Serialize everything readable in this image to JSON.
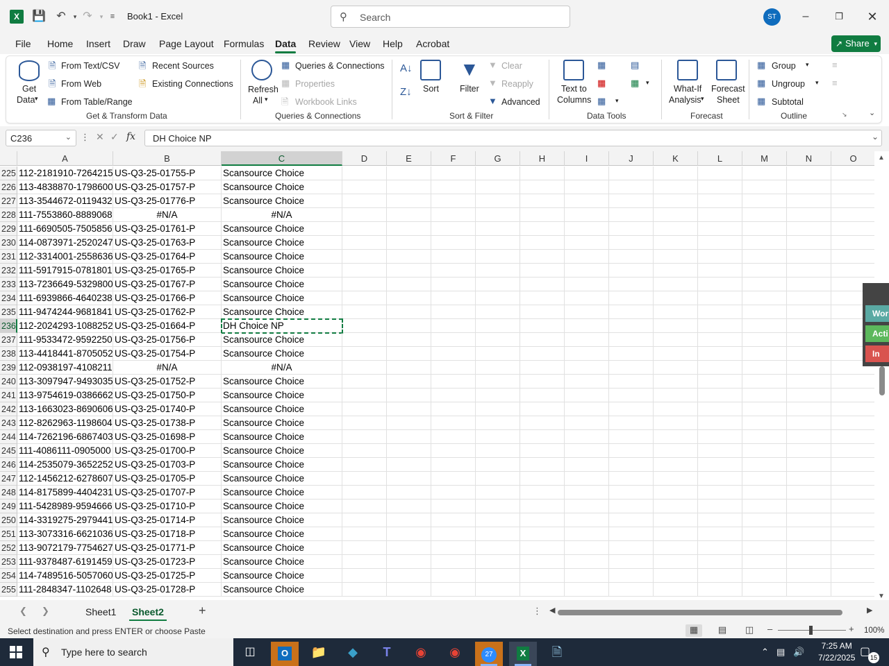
{
  "window": {
    "title": "Book1  -  Excel",
    "app_logo": "X",
    "search_placeholder": "Search",
    "user_initials": "ST"
  },
  "tabs": [
    {
      "label": "File"
    },
    {
      "label": "Home"
    },
    {
      "label": "Insert"
    },
    {
      "label": "Draw"
    },
    {
      "label": "Page Layout"
    },
    {
      "label": "Formulas"
    },
    {
      "label": "Data",
      "active": true
    },
    {
      "label": "Review"
    },
    {
      "label": "View"
    },
    {
      "label": "Help"
    },
    {
      "label": "Acrobat"
    }
  ],
  "share_label": "Share",
  "ribbon": {
    "get_transform": {
      "get_data": "Get",
      "get_data2": "Data",
      "from_text_csv": "From Text/CSV",
      "from_web": "From Web",
      "from_table_range": "From Table/Range",
      "recent_sources": "Recent Sources",
      "existing_connections": "Existing Connections",
      "group_label": "Get & Transform Data"
    },
    "queries": {
      "refresh": "Refresh",
      "refresh_all": "All",
      "queries_connections": "Queries & Connections",
      "properties": "Properties",
      "workbook_links": "Workbook Links",
      "group_label": "Queries & Connections"
    },
    "sort_filter": {
      "sort": "Sort",
      "filter": "Filter",
      "clear": "Clear",
      "reapply": "Reapply",
      "advanced": "Advanced",
      "group_label": "Sort & Filter"
    },
    "data_tools": {
      "text_to": "Text to",
      "columns": "Columns",
      "group_label": "Data Tools"
    },
    "forecast": {
      "what_if": "What-If",
      "analysis": "Analysis",
      "forecast": "Forecast",
      "sheet": "Sheet",
      "group_label": "Forecast"
    },
    "outline": {
      "group": "Group",
      "ungroup": "Ungroup",
      "subtotal": "Subtotal",
      "group_label": "Outline"
    }
  },
  "formula_bar": {
    "name_box": "C236",
    "fx": "fx",
    "content": "DH Choice NP"
  },
  "columns": [
    "A",
    "B",
    "C",
    "D",
    "E",
    "F",
    "G",
    "H",
    "I",
    "J",
    "K",
    "L",
    "M",
    "N",
    "O"
  ],
  "selected_column": "C",
  "selected_row": "236",
  "rows": [
    {
      "n": "225",
      "a": "112-2181910-7264215",
      "b": "US-Q3-25-01755-P",
      "c": "Scansource Choice"
    },
    {
      "n": "226",
      "a": "113-4838870-1798600",
      "b": "US-Q3-25-01757-P",
      "c": "Scansource Choice"
    },
    {
      "n": "227",
      "a": "113-3544672-0119432",
      "b": "US-Q3-25-01776-P",
      "c": "Scansource Choice"
    },
    {
      "n": "228",
      "a": "111-7553860-8889068",
      "b": "#N/A",
      "c": "#N/A"
    },
    {
      "n": "229",
      "a": "111-6690505-7505856",
      "b": "US-Q3-25-01761-P",
      "c": "Scansource Choice"
    },
    {
      "n": "230",
      "a": "114-0873971-2520247",
      "b": "US-Q3-25-01763-P",
      "c": "Scansource Choice"
    },
    {
      "n": "231",
      "a": "112-3314001-2558636",
      "b": "US-Q3-25-01764-P",
      "c": "Scansource Choice"
    },
    {
      "n": "232",
      "a": "111-5917915-0781801",
      "b": "US-Q3-25-01765-P",
      "c": "Scansource Choice"
    },
    {
      "n": "233",
      "a": "113-7236649-5329800",
      "b": "US-Q3-25-01767-P",
      "c": "Scansource Choice"
    },
    {
      "n": "234",
      "a": "111-6939866-4640238",
      "b": "US-Q3-25-01766-P",
      "c": "Scansource Choice"
    },
    {
      "n": "235",
      "a": "111-9474244-9681841",
      "b": "US-Q3-25-01762-P",
      "c": "Scansource Choice"
    },
    {
      "n": "236",
      "a": "112-2024293-1088252",
      "b": "US-Q3-25-01664-P",
      "c": "DH Choice NP"
    },
    {
      "n": "237",
      "a": "111-9533472-9592250",
      "b": "US-Q3-25-01756-P",
      "c": "Scansource Choice"
    },
    {
      "n": "238",
      "a": "113-4418441-8705052",
      "b": "US-Q3-25-01754-P",
      "c": "Scansource Choice"
    },
    {
      "n": "239",
      "a": "112-0938197-4108211",
      "b": "#N/A",
      "c": "#N/A"
    },
    {
      "n": "240",
      "a": "113-3097947-9493035",
      "b": "US-Q3-25-01752-P",
      "c": "Scansource Choice"
    },
    {
      "n": "241",
      "a": "113-9754619-0386662",
      "b": "US-Q3-25-01750-P",
      "c": "Scansource Choice"
    },
    {
      "n": "242",
      "a": "113-1663023-8690606",
      "b": "US-Q3-25-01740-P",
      "c": "Scansource Choice"
    },
    {
      "n": "243",
      "a": "112-8262963-1198604",
      "b": "US-Q3-25-01738-P",
      "c": "Scansource Choice"
    },
    {
      "n": "244",
      "a": "114-7262196-6867403",
      "b": "US-Q3-25-01698-P",
      "c": "Scansource Choice"
    },
    {
      "n": "245",
      "a": "111-4086111-0905000",
      "b": "US-Q3-25-01700-P",
      "c": "Scansource Choice"
    },
    {
      "n": "246",
      "a": "114-2535079-3652252",
      "b": "US-Q3-25-01703-P",
      "c": "Scansource Choice"
    },
    {
      "n": "247",
      "a": "112-1456212-6278607",
      "b": "US-Q3-25-01705-P",
      "c": "Scansource Choice"
    },
    {
      "n": "248",
      "a": "114-8175899-4404231",
      "b": "US-Q3-25-01707-P",
      "c": "Scansource Choice"
    },
    {
      "n": "249",
      "a": "111-5428989-9594666",
      "b": "US-Q3-25-01710-P",
      "c": "Scansource Choice"
    },
    {
      "n": "250",
      "a": "114-3319275-2979441",
      "b": "US-Q3-25-01714-P",
      "c": "Scansource Choice"
    },
    {
      "n": "251",
      "a": "113-3073316-6621036",
      "b": "US-Q3-25-01718-P",
      "c": "Scansource Choice"
    },
    {
      "n": "252",
      "a": "113-9072179-7754627",
      "b": "US-Q3-25-01771-P",
      "c": "Scansource Choice"
    },
    {
      "n": "253",
      "a": "111-9378487-6191459",
      "b": "US-Q3-25-01723-P",
      "c": "Scansource Choice"
    },
    {
      "n": "254",
      "a": "114-7489516-5057060",
      "b": "US-Q3-25-01725-P",
      "c": "Scansource Choice"
    },
    {
      "n": "255",
      "a": "111-2848347-1102648",
      "b": "US-Q3-25-01728-P",
      "c": "Scansource Choice"
    }
  ],
  "sheets": [
    {
      "label": "Sheet1"
    },
    {
      "label": "Sheet2",
      "active": true
    }
  ],
  "side_panel": {
    "btn1": "Wor",
    "btn2": "Acti",
    "btn3": "In Ac"
  },
  "status": {
    "message": "Select destination and press ENTER or choose Paste",
    "zoom": "100%"
  },
  "taskbar": {
    "search_placeholder": "Type here to search",
    "time": "7:25 AM",
    "date": "7/22/2025",
    "notifications": "15",
    "zoom_badge": "27"
  },
  "colors": {
    "accent": "#107c41",
    "na_text": "#000000"
  }
}
